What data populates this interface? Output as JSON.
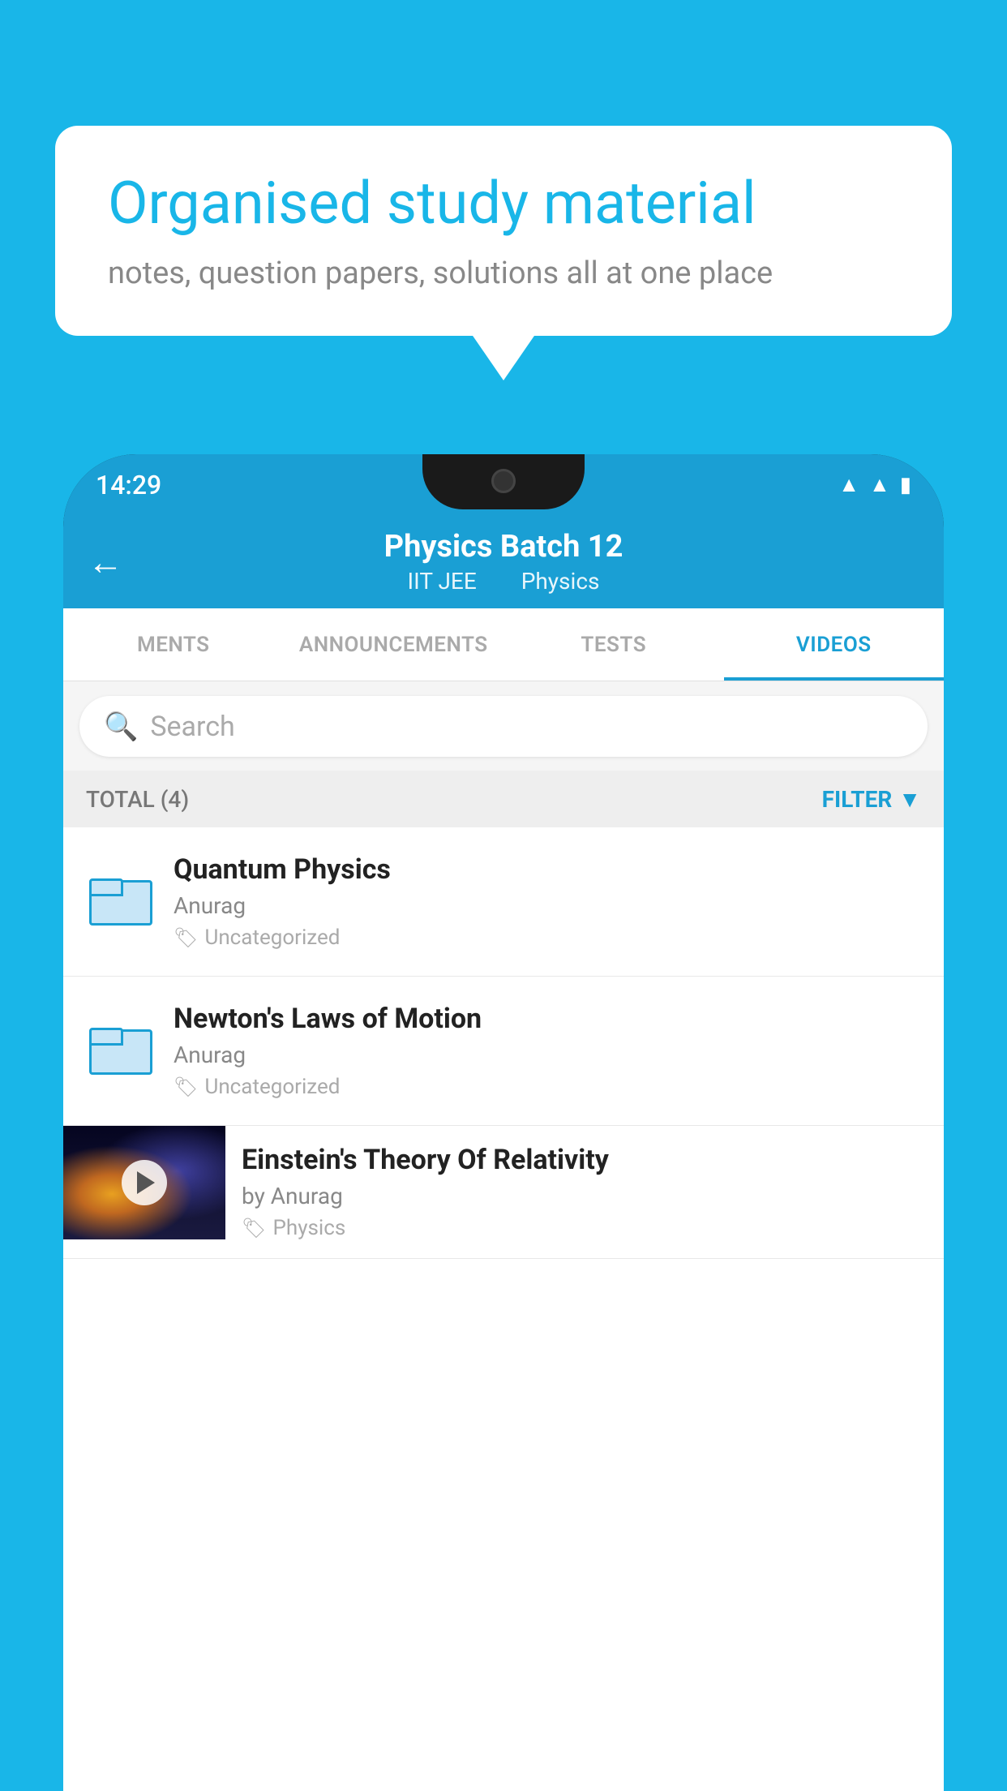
{
  "background_color": "#19b6e8",
  "bubble": {
    "title": "Organised study material",
    "subtitle": "notes, question papers, solutions all at one place"
  },
  "status_bar": {
    "time": "14:29",
    "icons": [
      "▲",
      "▲",
      "▮"
    ]
  },
  "header": {
    "back_label": "←",
    "title": "Physics Batch 12",
    "subtitle_part1": "IIT JEE",
    "subtitle_part2": "Physics"
  },
  "tabs": [
    {
      "label": "MENTS",
      "active": false
    },
    {
      "label": "ANNOUNCEMENTS",
      "active": false
    },
    {
      "label": "TESTS",
      "active": false
    },
    {
      "label": "VIDEOS",
      "active": true
    }
  ],
  "search": {
    "placeholder": "Search"
  },
  "filter": {
    "total_label": "TOTAL (4)",
    "filter_label": "FILTER"
  },
  "list_items": [
    {
      "type": "folder",
      "title": "Quantum Physics",
      "author": "Anurag",
      "tag": "Uncategorized"
    },
    {
      "type": "folder",
      "title": "Newton's Laws of Motion",
      "author": "Anurag",
      "tag": "Uncategorized"
    },
    {
      "type": "video",
      "title": "Einstein's Theory Of Relativity",
      "author": "by Anurag",
      "tag": "Physics"
    }
  ]
}
